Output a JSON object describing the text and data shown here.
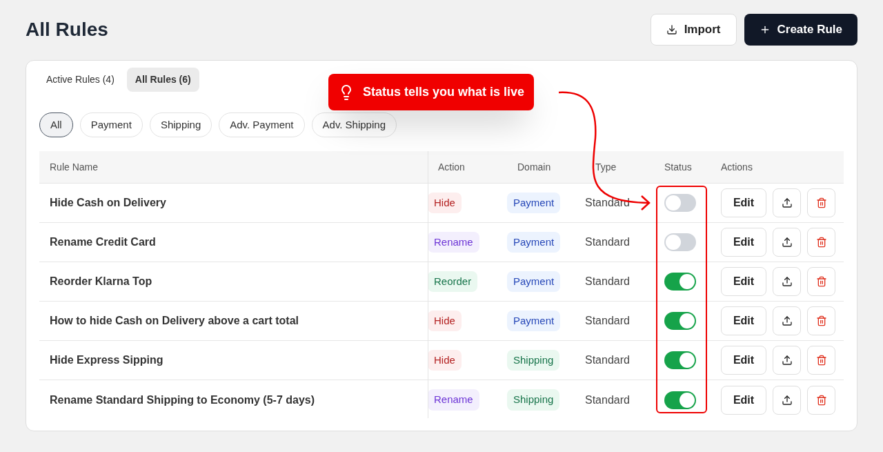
{
  "page": {
    "title": "All Rules"
  },
  "header_buttons": [
    {
      "label": "Import",
      "kind": "secondary"
    },
    {
      "label": "Create Rule",
      "kind": "primary"
    }
  ],
  "tabs": [
    {
      "label": "Active Rules (4)",
      "selected": false
    },
    {
      "label": "All Rules (6)",
      "selected": true
    }
  ],
  "filters": [
    {
      "label": "All",
      "selected": true
    },
    {
      "label": "Payment",
      "selected": false
    },
    {
      "label": "Shipping",
      "selected": false
    },
    {
      "label": "Adv. Payment",
      "selected": false
    },
    {
      "label": "Adv. Shipping",
      "selected": false
    }
  ],
  "table": {
    "columns": [
      "Rule Name",
      "Action",
      "Domain",
      "Type",
      "Status",
      "Actions"
    ],
    "rows": [
      {
        "name": "Hide Cash on Delivery",
        "action": {
          "label": "Hide",
          "kind": "hide"
        },
        "domain": {
          "label": "Payment",
          "kind": "payment"
        },
        "type": "Standard",
        "on": false,
        "edit": "Edit"
      },
      {
        "name": "Rename Credit Card",
        "action": {
          "label": "Rename",
          "kind": "rename"
        },
        "domain": {
          "label": "Payment",
          "kind": "payment"
        },
        "type": "Standard",
        "on": false,
        "edit": "Edit"
      },
      {
        "name": "Reorder Klarna Top",
        "action": {
          "label": "Reorder",
          "kind": "reorder"
        },
        "domain": {
          "label": "Payment",
          "kind": "payment"
        },
        "type": "Standard",
        "on": true,
        "edit": "Edit"
      },
      {
        "name": "How to hide Cash on Delivery above a cart total",
        "action": {
          "label": "Hide",
          "kind": "hide"
        },
        "domain": {
          "label": "Payment",
          "kind": "payment"
        },
        "type": "Standard",
        "on": true,
        "edit": "Edit"
      },
      {
        "name": "Hide Express Sipping",
        "action": {
          "label": "Hide",
          "kind": "hide"
        },
        "domain": {
          "label": "Shipping",
          "kind": "shipping"
        },
        "type": "Standard",
        "on": true,
        "edit": "Edit"
      },
      {
        "name": "Rename Standard Shipping to Economy (5-7 days)",
        "action": {
          "label": "Rename",
          "kind": "rename"
        },
        "domain": {
          "label": "Shipping",
          "kind": "shipping"
        },
        "type": "Standard",
        "on": true,
        "edit": "Edit"
      }
    ]
  },
  "callout": {
    "text": "Status tells you what is live"
  }
}
